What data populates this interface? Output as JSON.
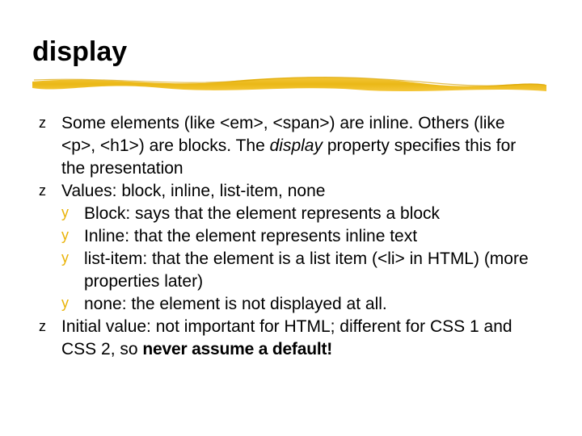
{
  "title": "display",
  "bullets": [
    {
      "segments": [
        {
          "t": "Some elements (like <em>, <span>) are inline. Others (like <p>, <h1>) are blocks. The "
        },
        {
          "t": "display",
          "em": true
        },
        {
          "t": " property specifies this for the presentation"
        }
      ]
    },
    {
      "segments": [
        {
          "t": "Values: block, inline, list-item, none"
        }
      ],
      "subs": [
        {
          "segments": [
            {
              "t": "Block: says that the element represents a block"
            }
          ]
        },
        {
          "segments": [
            {
              "t": "Inline: that the element represents inline text"
            }
          ]
        },
        {
          "segments": [
            {
              "t": "list-item: that the element is a list item (<li> in HTML) (more properties later)"
            }
          ]
        },
        {
          "segments": [
            {
              "t": "none: the element is not displayed at all."
            }
          ]
        }
      ]
    },
    {
      "segments": [
        {
          "t": "Initial value: not important for HTML; different for CSS 1 and CSS 2, so "
        },
        {
          "t": "never assume a default!",
          "strong": true
        }
      ]
    }
  ]
}
